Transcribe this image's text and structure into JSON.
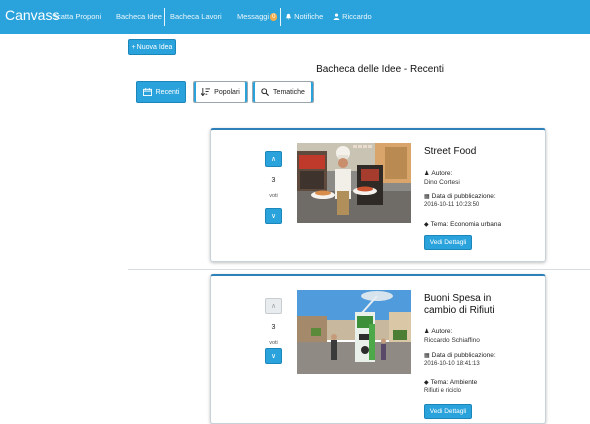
{
  "navbar": {
    "brand": "Canvass",
    "items": [
      {
        "label": "Scatta Proponi"
      },
      {
        "label": "Bacheca Idee"
      },
      {
        "label": "Bacheca Lavori"
      },
      {
        "label": "Messaggi",
        "badge": "0"
      },
      {
        "label": "Notifiche"
      },
      {
        "label": "Riccardo"
      }
    ]
  },
  "toolbar": {
    "new_idea_label": "Nuova Idea"
  },
  "page": {
    "title": "Bacheca delle Idee - Recenti"
  },
  "tabs": [
    {
      "label": "Recenti",
      "active": true
    },
    {
      "label": "Popolari",
      "active": false
    },
    {
      "label": "Tematiche",
      "active": false
    }
  ],
  "ideas": [
    {
      "title": "Street Food",
      "votes": "3",
      "votes_label": "voti",
      "author_label": "Autore:",
      "author": "Dino Cortesi",
      "published_label": "Data di pubblicazione:",
      "published": "2016-10-11 10:23:50",
      "theme_label": "Tema: Economia urbana",
      "details_label": "Vedi Dettagli"
    },
    {
      "title": "Buoni Spesa in cambio di Rifiuti",
      "votes": "3",
      "votes_label": "voti",
      "author_label": "Autore:",
      "author": "Riccardo Schiaffino",
      "published_label": "Data di pubblicazione:",
      "published": "2016-10-10 18:41:13",
      "theme_label": "Tema: Ambiente",
      "theme_value": "Rifiuti e riciclo",
      "details_label": "Vedi Dettagli"
    }
  ],
  "colors": {
    "primary": "#2aa3dc",
    "card_border": "#2d80b8",
    "badge": "#f0ad4e"
  }
}
